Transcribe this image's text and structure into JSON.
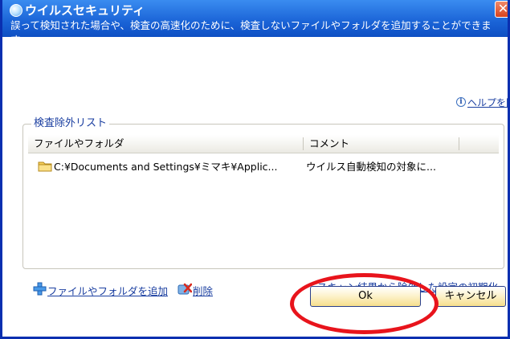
{
  "window": {
    "title": "ウイルスセキュリティ",
    "close_glyph": "✕",
    "description": "誤って検知された場合や、検査の高速化のために、検査しないファイルやフォルダを追加することができます。"
  },
  "help": {
    "icon": "info-icon",
    "label": "ヘルプを開く"
  },
  "exclusion_group": {
    "label": "検査除外リスト",
    "columns": [
      "ファイルやフォルダ",
      "コメント"
    ],
    "rows": [
      {
        "icon": "folder-icon",
        "path": "C:¥Documents and Settings¥ミマキ¥Applic...",
        "comment": "ウイルス自動検知の対象に..."
      }
    ]
  },
  "actions": {
    "add_label": "ファイルやフォルダを追加",
    "add_icon": "add-plus-icon",
    "delete_label": "削除",
    "delete_icon": "delete-icon",
    "reset_label": "スキャン結果から除外した設定の初期化"
  },
  "buttons": {
    "ok": "Ok",
    "cancel": "キャンセル"
  },
  "colors": {
    "titlebar": "#1a63d6",
    "link": "#1a3ea0",
    "button_fill": "#f6df8c",
    "highlight": "#e8141c"
  }
}
